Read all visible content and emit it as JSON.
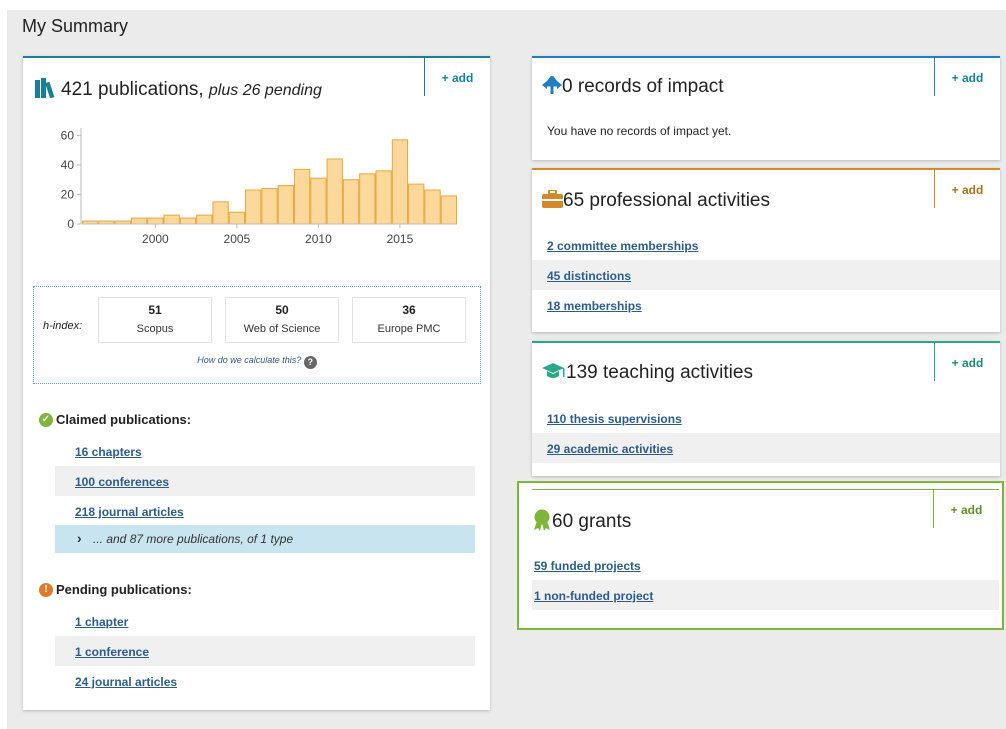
{
  "page_title": "My Summary",
  "add_label": "+ add",
  "colors": {
    "publications": "#1a7d9a",
    "impact": "#1f7fbf",
    "professional": "#d08a2e",
    "teaching": "#2aa88a",
    "grants": "#7fb539",
    "bar_fill": "#fcd89b",
    "bar_stroke": "#e8a63f"
  },
  "publications": {
    "count_title": "421 publications,",
    "pending_title": "plus 26 pending",
    "icon": "books-icon",
    "chart_data": {
      "type": "bar",
      "x": [
        1996,
        1997,
        1998,
        1999,
        2000,
        2001,
        2002,
        2003,
        2004,
        2005,
        2006,
        2007,
        2008,
        2009,
        2010,
        2011,
        2012,
        2013,
        2014,
        2015,
        2016,
        2017,
        2018
      ],
      "values": [
        2,
        2,
        2,
        4,
        4,
        6,
        4,
        6,
        15,
        8,
        23,
        24,
        26,
        37,
        31,
        44,
        30,
        34,
        36,
        57,
        27,
        23,
        19
      ],
      "xticks": [
        "2000",
        "2005",
        "2010",
        "2015"
      ],
      "yticks": [
        "0",
        "20",
        "40",
        "60"
      ],
      "ylim": [
        0,
        65
      ]
    },
    "hindex": {
      "label": "h-index:",
      "items": [
        {
          "value": "51",
          "source": "Scopus"
        },
        {
          "value": "50",
          "source": "Web of Science"
        },
        {
          "value": "36",
          "source": "Europe PMC"
        }
      ],
      "help_text": "How do we calculate this?"
    },
    "claimed": {
      "heading": "Claimed publications:",
      "items": [
        "16 chapters",
        "100 conferences",
        "218 journal articles"
      ],
      "more": "... and 87 more publications, of 1 type"
    },
    "pending": {
      "heading": "Pending publications:",
      "items": [
        "1 chapter",
        "1 conference",
        "24 journal articles"
      ]
    }
  },
  "impact": {
    "title": "0 records of impact",
    "icon": "impact-arrows-icon",
    "empty_text": "You have no records of impact yet."
  },
  "professional": {
    "title": "65 professional activities",
    "icon": "briefcase-icon",
    "items": [
      "2 committee memberships",
      "45 distinctions",
      "18 memberships"
    ]
  },
  "teaching": {
    "title": "139 teaching activities",
    "icon": "graduation-cap-icon",
    "items": [
      "110 thesis supervisions",
      "29 academic activities"
    ]
  },
  "grants": {
    "title": "60 grants",
    "icon": "award-ribbon-icon",
    "items": [
      "59 funded projects",
      "1 non-funded project"
    ]
  }
}
